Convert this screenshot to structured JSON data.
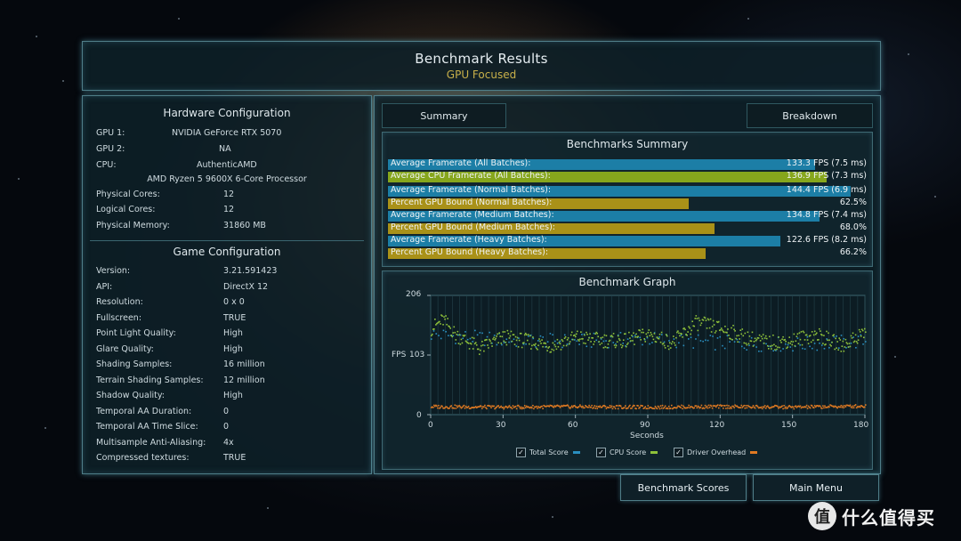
{
  "title": {
    "main": "Benchmark Results",
    "sub": "GPU Focused"
  },
  "hardware": {
    "header": "Hardware Configuration",
    "rows": [
      {
        "k": "GPU 1:",
        "v": "NVIDIA GeForce RTX 5070"
      },
      {
        "k": "GPU 2:",
        "v": "NA"
      },
      {
        "k": "CPU:",
        "v": "AuthenticAMD"
      }
    ],
    "cpu_name": "AMD Ryzen 5 9600X 6-Core Processor",
    "rows2": [
      {
        "k": "Physical Cores:",
        "v": "12"
      },
      {
        "k": "Logical Cores:",
        "v": "12"
      },
      {
        "k": "Physical Memory:",
        "v": "31860  MB"
      }
    ]
  },
  "game": {
    "header": "Game Configuration",
    "rows": [
      {
        "k": "Version:",
        "v": "3.21.591423"
      },
      {
        "k": "API:",
        "v": "DirectX 12"
      },
      {
        "k": "Resolution:",
        "v": "0 x 0"
      },
      {
        "k": "Fullscreen:",
        "v": "TRUE"
      },
      {
        "k": "Point Light Quality:",
        "v": "High"
      },
      {
        "k": "Glare Quality:",
        "v": "High"
      },
      {
        "k": "Shading Samples:",
        "v": "16 million"
      },
      {
        "k": "Terrain Shading Samples:",
        "v": "12 million"
      },
      {
        "k": "Shadow Quality:",
        "v": "High"
      },
      {
        "k": "Temporal AA Duration:",
        "v": "0"
      },
      {
        "k": "Temporal AA Time Slice:",
        "v": "0"
      },
      {
        "k": "Multisample Anti-Aliasing:",
        "v": "4x"
      },
      {
        "k": "Compressed textures:",
        "v": "TRUE"
      }
    ]
  },
  "tabs": {
    "summary": "Summary",
    "breakdown": "Breakdown"
  },
  "summary": {
    "header": "Benchmarks Summary",
    "max_fps": 150,
    "rows": [
      {
        "label": "Average Framerate (All Batches):",
        "value": "133.3 FPS (7.5 ms)",
        "fps": 133.3,
        "kind": "fps"
      },
      {
        "label": "Average CPU Framerate (All Batches):",
        "value": "136.9 FPS (7.3 ms)",
        "fps": 136.9,
        "kind": "cpu"
      },
      {
        "label": "Average Framerate (Normal Batches):",
        "value": "144.4 FPS (6.9 ms)",
        "fps": 144.4,
        "kind": "fps"
      },
      {
        "label": "Percent GPU Bound (Normal Batches):",
        "value": "62.5%",
        "pct": 62.5,
        "kind": "pct"
      },
      {
        "label": "Average Framerate (Medium Batches):",
        "value": "134.8 FPS (7.4 ms)",
        "fps": 134.8,
        "kind": "fps"
      },
      {
        "label": "Percent GPU Bound (Medium Batches):",
        "value": "68.0%",
        "pct": 68.0,
        "kind": "pct"
      },
      {
        "label": "Average Framerate (Heavy Batches):",
        "value": "122.6 FPS (8.2 ms)",
        "fps": 122.6,
        "kind": "fps"
      },
      {
        "label": "Percent GPU Bound (Heavy Batches):",
        "value": "66.2%",
        "pct": 66.2,
        "kind": "pct"
      }
    ]
  },
  "graph": {
    "header": "Benchmark Graph",
    "ylabel": "FPS",
    "xlabel": "Seconds",
    "yticks": [
      "206",
      "103",
      "0"
    ],
    "xticks": [
      "0",
      "30",
      "60",
      "90",
      "120",
      "150",
      "180"
    ],
    "legend": [
      {
        "label": "Total Score",
        "color": "#2a8fc0"
      },
      {
        "label": "CPU Score",
        "color": "#8fc23a"
      },
      {
        "label": "Driver Overhead",
        "color": "#e07a22"
      }
    ]
  },
  "chart_data": {
    "type": "scatter",
    "title": "Benchmark Graph",
    "xlabel": "Seconds",
    "ylabel": "FPS",
    "xlim": [
      0,
      180
    ],
    "ylim": [
      0,
      206
    ],
    "grid": true,
    "legend_position": "bottom",
    "series": [
      {
        "name": "Total Score",
        "color": "#2a8fc0",
        "x": [
          0,
          30,
          60,
          90,
          120,
          150,
          180
        ],
        "y": [
          140,
          130,
          128,
          132,
          125,
          122,
          128
        ]
      },
      {
        "name": "CPU Score",
        "color": "#8fc23a",
        "x": [
          0,
          5,
          10,
          20,
          30,
          40,
          50,
          60,
          70,
          80,
          90,
          100,
          110,
          120,
          130,
          140,
          150,
          160,
          170,
          180
        ],
        "y": [
          150,
          165,
          140,
          115,
          135,
          128,
          120,
          135,
          130,
          128,
          140,
          125,
          160,
          150,
          135,
          125,
          130,
          140,
          120,
          145
        ]
      },
      {
        "name": "Driver Overhead",
        "color": "#e07a22",
        "x": [
          0,
          30,
          60,
          90,
          120,
          150,
          180
        ],
        "y": [
          15,
          14,
          15,
          14,
          15,
          14,
          16
        ]
      }
    ]
  },
  "buttons": {
    "scores": "Benchmark Scores",
    "menu": "Main Menu"
  },
  "watermark": {
    "text": "什么值得买",
    "logo": "值"
  }
}
